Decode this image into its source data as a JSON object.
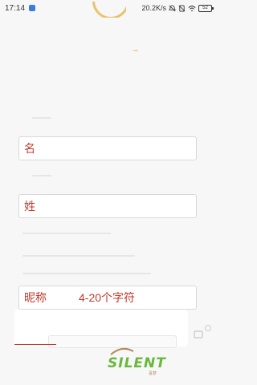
{
  "status_bar": {
    "time": "17:14",
    "app_badge": "",
    "net_speed": "20.2K/s",
    "battery": "52"
  },
  "form": {
    "first_name_label": "名",
    "last_name_label": "姓",
    "nickname_label": "昵称",
    "nickname_hint": "4-20个字符"
  },
  "watermark": {
    "brand": "SILENT",
    "sub": "喜梦"
  },
  "colors": {
    "accent": "#c23a2c",
    "logo_arc": "#e9c36b",
    "watermark": "#68b83b"
  }
}
